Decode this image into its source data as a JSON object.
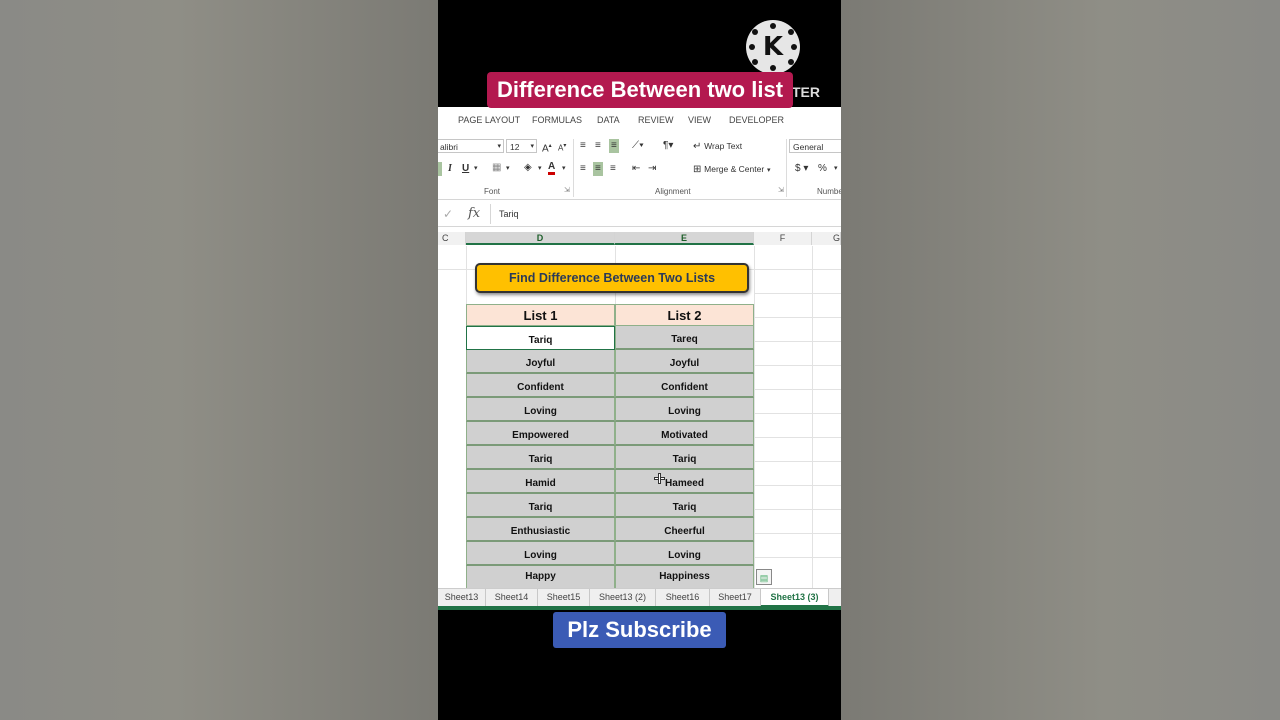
{
  "overlay": {
    "title": "Difference Between two list",
    "brand_letter": "K",
    "brand_suffix": "TER",
    "subscribe": "Plz Subscribe"
  },
  "ribbon": {
    "tabs": [
      "PAGE LAYOUT",
      "FORMULAS",
      "DATA",
      "REVIEW",
      "VIEW",
      "DEVELOPER"
    ],
    "font_name": "alibri",
    "font_size": "12",
    "wrap_text": "Wrap Text",
    "merge_center": "Merge & Center",
    "number_format": "General",
    "group_font": "Font",
    "group_alignment": "Alignment",
    "group_number": "Numbe"
  },
  "formula_bar": {
    "value": "Tariq"
  },
  "columns": [
    "C",
    "D",
    "E",
    "F",
    "G"
  ],
  "sheet": {
    "button_label": "Find Difference Between Two Lists",
    "header_list1": "List 1",
    "header_list2": "List 2",
    "list1": [
      "Tariq",
      "Joyful",
      "Confident",
      "Loving",
      "Empowered",
      "Tariq",
      "Hamid",
      "Tariq",
      "Enthusiastic",
      "Loving",
      "Happy"
    ],
    "list2": [
      "Tareq",
      "Joyful",
      "Confident",
      "Loving",
      "Motivated",
      "Tariq",
      "Hameed",
      "Tariq",
      "Cheerful",
      "Loving",
      "Happiness"
    ]
  },
  "sheet_tabs": [
    "Sheet13",
    "Sheet14",
    "Sheet15",
    "Sheet13 (2)",
    "Sheet16",
    "Sheet17",
    "Sheet13 (3)"
  ],
  "active_sheet": "Sheet13 (3)"
}
